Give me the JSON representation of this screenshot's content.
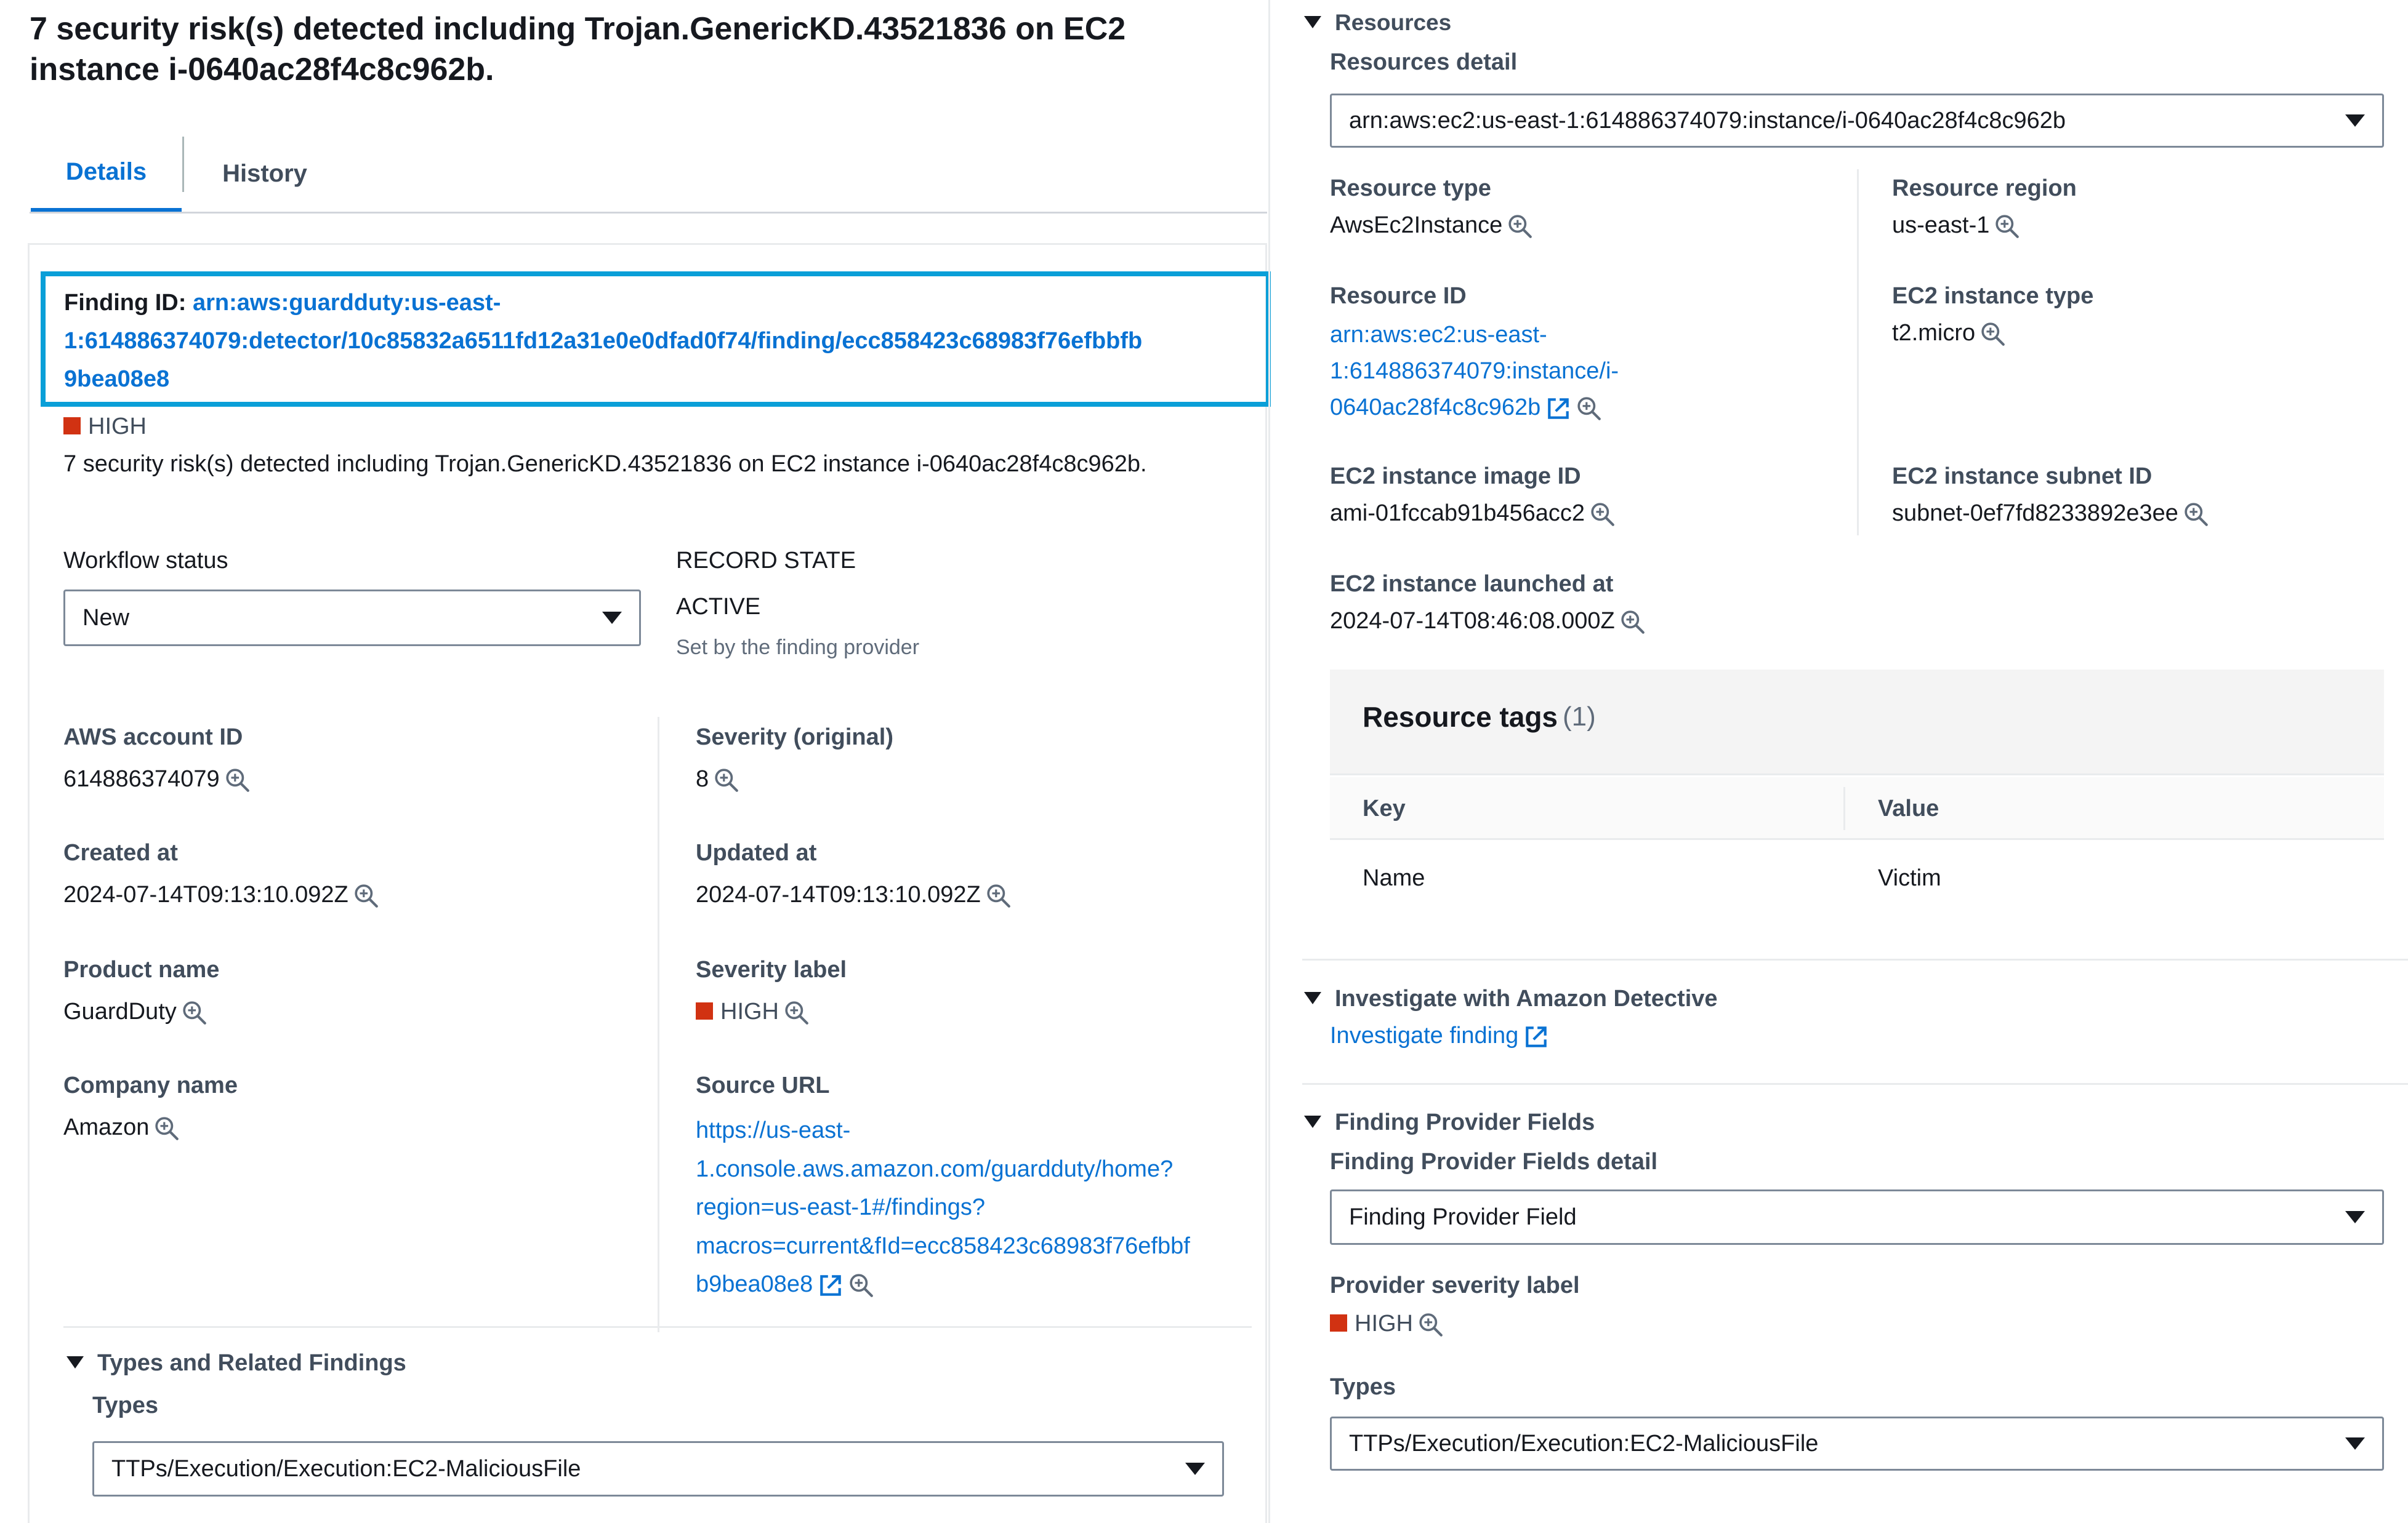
{
  "page_title": "7 security risk(s) detected including Trojan.GenericKD.43521836 on EC2 instance i-0640ac28f4c8c962b.",
  "tabs": [
    {
      "label": "Details"
    },
    {
      "label": "History"
    }
  ],
  "finding": {
    "id_label": "Finding ID:",
    "id_value": "arn:aws:guardduty:us-east-1:614886374079:detector/10c85832a6511fd12a31e0e0dfad0f74/finding/ecc858423c68983f76efbbfb9bea08e8",
    "id_lines": [
      "arn:aws:guardduty:us-east-",
      "1:614886374079:detector/10c85832a6511fd12a31e0e0dfad0f74/finding/ecc858423c68983f76efbbfb",
      "9bea08e8"
    ],
    "severity": "HIGH",
    "description": "7 security risk(s) detected including Trojan.GenericKD.43521836 on EC2 instance i-0640ac28f4c8c962b."
  },
  "workflow": {
    "label": "Workflow status",
    "value": "New"
  },
  "record_state": {
    "label": "RECORD STATE",
    "value": "ACTIVE",
    "note": "Set by the finding provider"
  },
  "fields": {
    "aws_account_id": {
      "label": "AWS account ID",
      "value": "614886374079"
    },
    "severity_original": {
      "label": "Severity (original)",
      "value": "8"
    },
    "created_at": {
      "label": "Created at",
      "value": "2024-07-14T09:13:10.092Z"
    },
    "updated_at": {
      "label": "Updated at",
      "value": "2024-07-14T09:13:10.092Z"
    },
    "product_name": {
      "label": "Product name",
      "value": "GuardDuty"
    },
    "severity_label": {
      "label": "Severity label",
      "value": "HIGH"
    },
    "company_name": {
      "label": "Company name",
      "value": "Amazon"
    },
    "source_url": {
      "label": "Source URL",
      "value": "https://us-east-1.console.aws.amazon.com/guardduty/home?region=us-east-1#/findings?macros=current&fId=ecc858423c68983f76efbbfb9bea08e8",
      "lines": [
        "https://us-east-",
        "1.console.aws.amazon.com/guardduty/home?",
        "region=us-east-1#/findings?",
        "macros=current&fId=ecc858423c68983f76efbbf",
        "b9bea08e8"
      ]
    }
  },
  "types_section": {
    "title": "Types and Related Findings",
    "types_label": "Types",
    "types_value": "TTPs/Execution/Execution:EC2-MaliciousFile"
  },
  "resources": {
    "title": "Resources",
    "detail_label": "Resources detail",
    "detail_value": "arn:aws:ec2:us-east-1:614886374079:instance/i-0640ac28f4c8c962b",
    "resource_type": {
      "label": "Resource type",
      "value": "AwsEc2Instance"
    },
    "resource_region": {
      "label": "Resource region",
      "value": "us-east-1"
    },
    "resource_id": {
      "label": "Resource ID",
      "value": "arn:aws:ec2:us-east-1:614886374079:instance/i-0640ac28f4c8c962b",
      "lines": [
        "arn:aws:ec2:us-east-",
        "1:614886374079:instance/i-",
        "0640ac28f4c8c962b"
      ]
    },
    "instance_type": {
      "label": "EC2 instance type",
      "value": "t2.micro"
    },
    "image_id": {
      "label": "EC2 instance image ID",
      "value": "ami-01fccab91b456acc2"
    },
    "subnet_id": {
      "label": "EC2 instance subnet ID",
      "value": "subnet-0ef7fd8233892e3ee"
    },
    "launched_at": {
      "label": "EC2 instance launched at",
      "value": "2024-07-14T08:46:08.000Z"
    },
    "tags": {
      "title": "Resource tags",
      "count": "(1)",
      "columns": [
        "Key",
        "Value"
      ],
      "rows": [
        {
          "key": "Name",
          "value": "Victim"
        }
      ]
    }
  },
  "detective": {
    "title": "Investigate with Amazon Detective",
    "link": "Investigate finding"
  },
  "provider_fields": {
    "title": "Finding Provider Fields",
    "detail_label": "Finding Provider Fields detail",
    "detail_value": "Finding Provider Field",
    "severity_label": "Provider severity label",
    "severity_value": "HIGH",
    "types_label": "Types",
    "types_value": "TTPs/Execution/Execution:EC2-MaliciousFile"
  },
  "colors": {
    "link": "#0972d3",
    "highlight_border": "#0a9fd8",
    "severity_high": "#d13212",
    "text": "#16191f"
  },
  "icons": [
    "zoom-in-icon",
    "external-link-icon",
    "caret-down-icon",
    "expand-triangle-icon",
    "severity-square-icon"
  ]
}
